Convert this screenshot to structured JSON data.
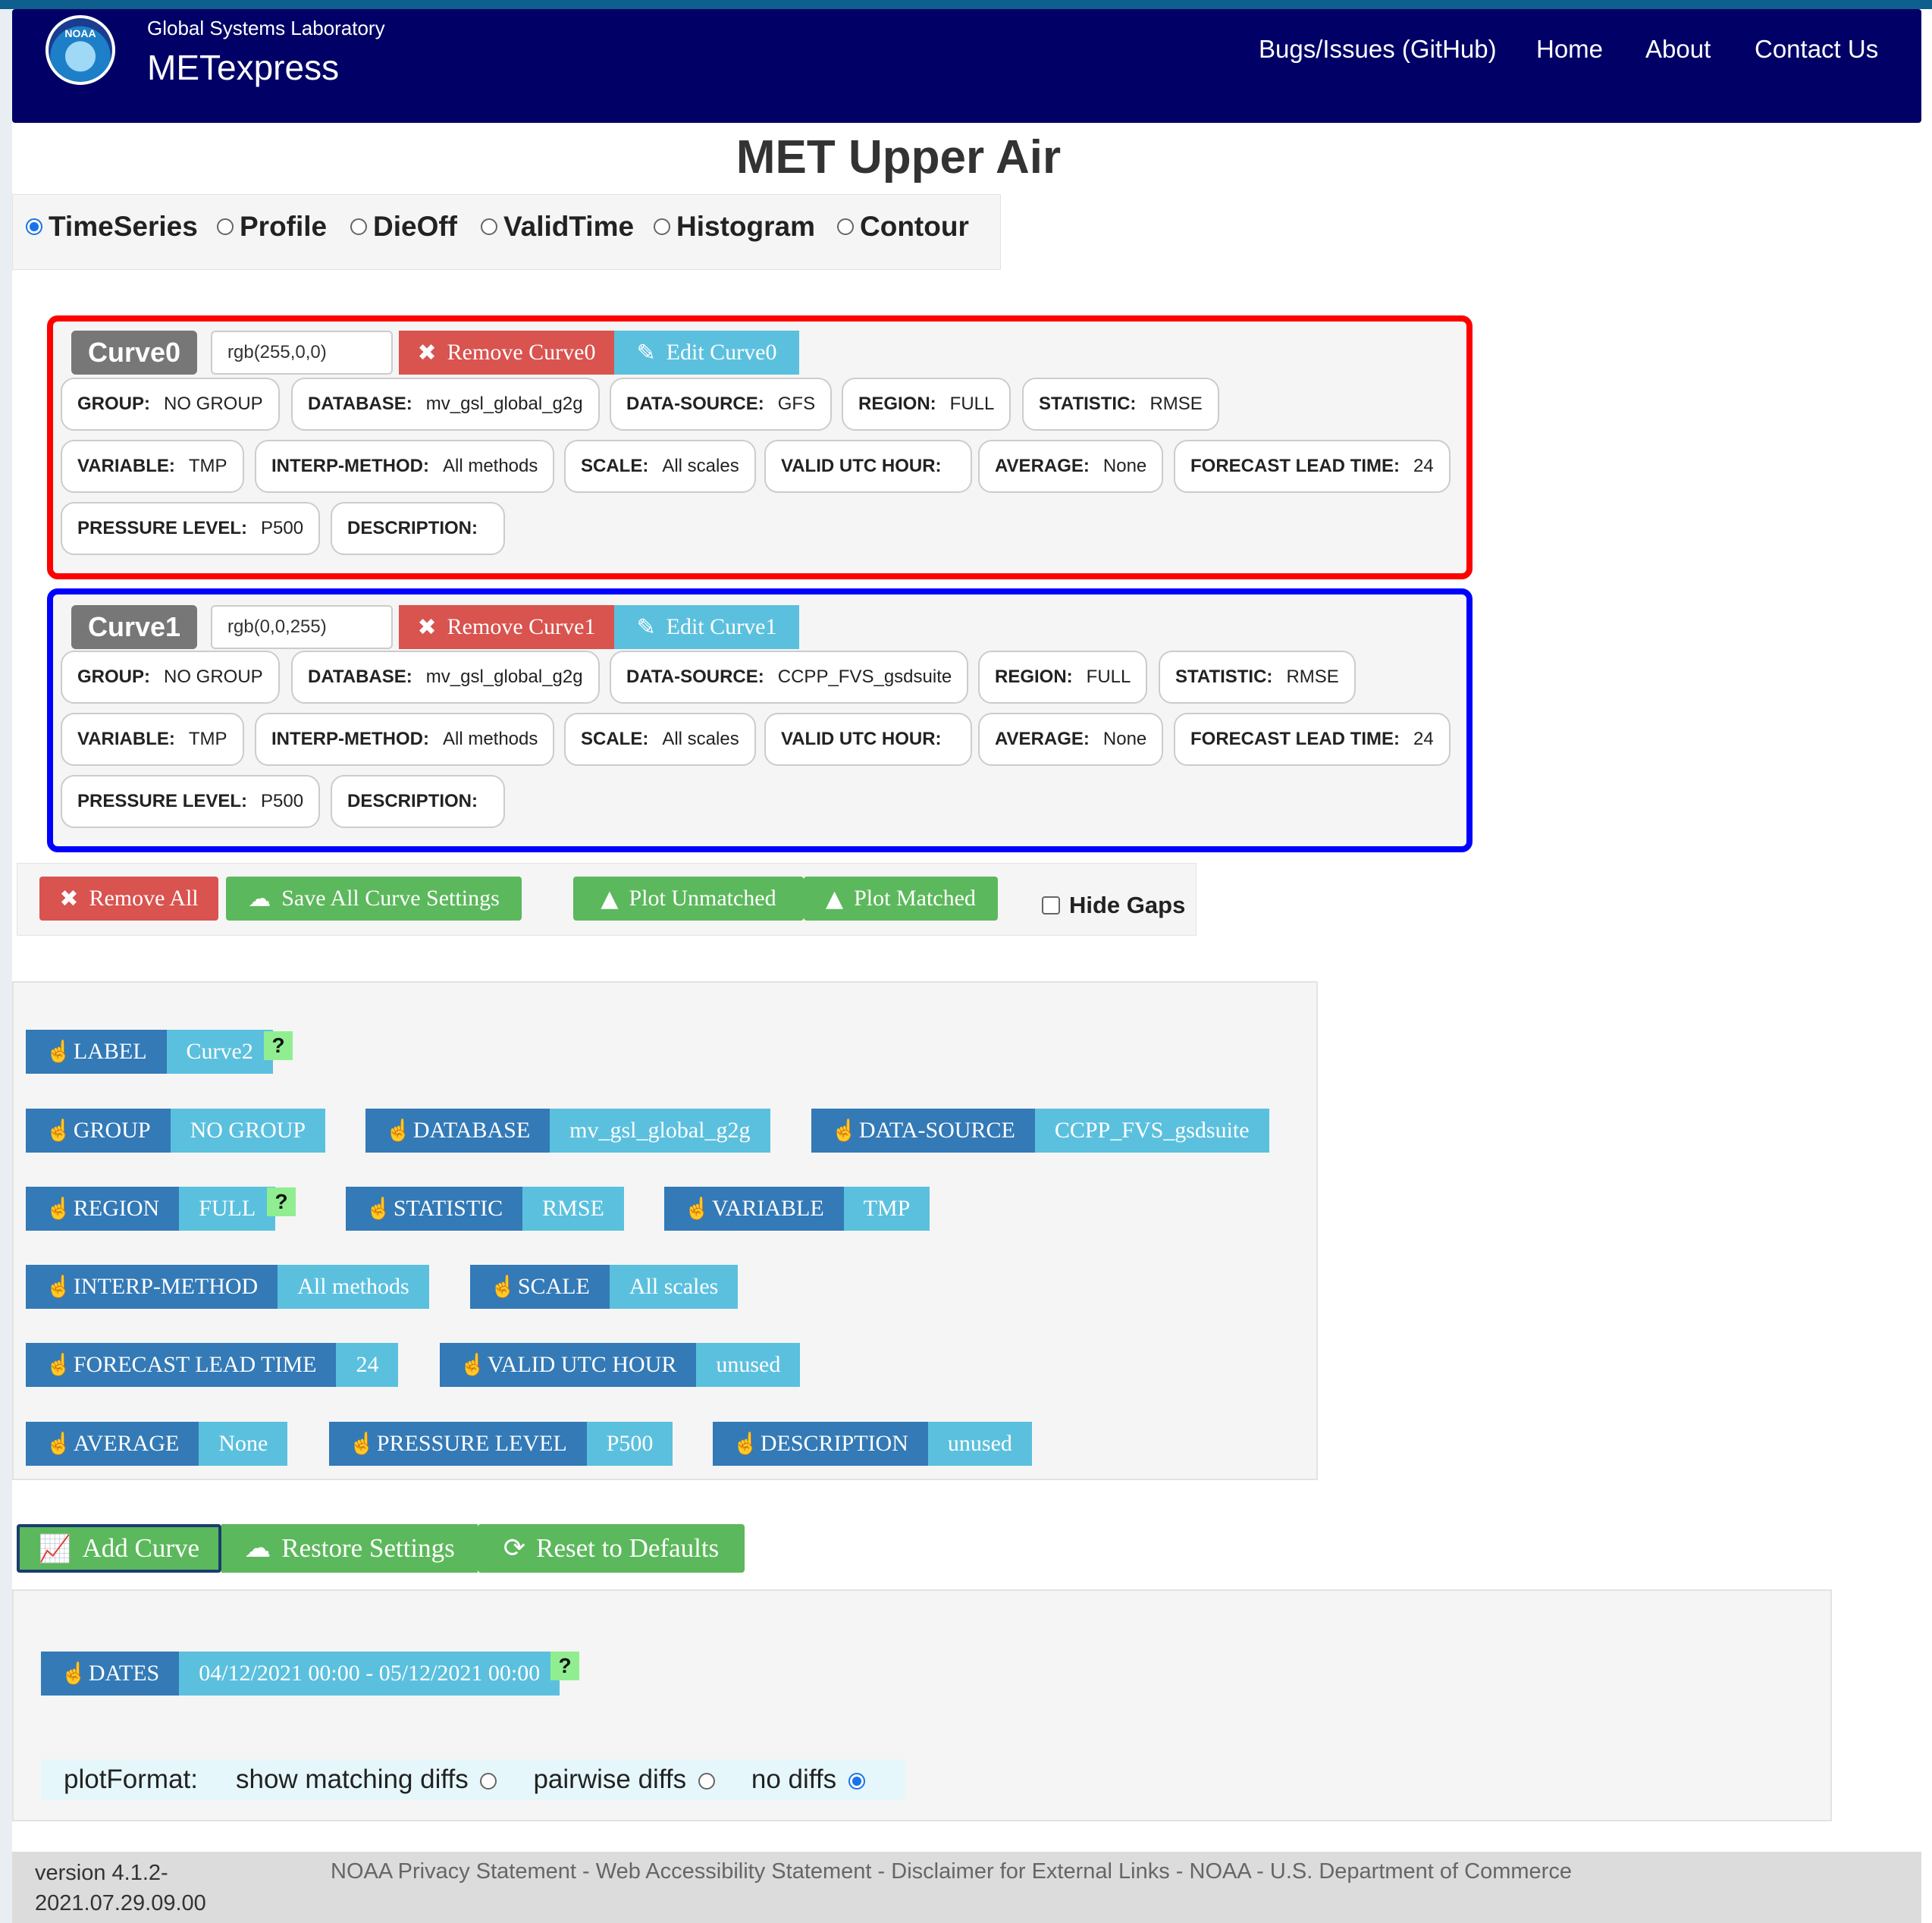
{
  "navbar": {
    "org": "Global Systems Laboratory",
    "app": "METexpress",
    "logo_text": "NOAA",
    "links": [
      "Bugs/Issues (GitHub)",
      "Home",
      "About",
      "Contact Us"
    ]
  },
  "page_title": "MET Upper Air",
  "plot_types": [
    {
      "label": "TimeSeries",
      "selected": true
    },
    {
      "label": "Profile",
      "selected": false
    },
    {
      "label": "DieOff",
      "selected": false
    },
    {
      "label": "ValidTime",
      "selected": false
    },
    {
      "label": "Histogram",
      "selected": false
    },
    {
      "label": "Contour",
      "selected": false
    }
  ],
  "curves": [
    {
      "label": "Curve0",
      "color": "rgb(255,0,0)",
      "border_color": "#ff0000",
      "remove_label": "Remove Curve0",
      "edit_label": "Edit Curve0",
      "fields": [
        {
          "k": "GROUP:",
          "v": "NO GROUP"
        },
        {
          "k": "DATABASE:",
          "v": "mv_gsl_global_g2g"
        },
        {
          "k": "DATA-SOURCE:",
          "v": "GFS"
        },
        {
          "k": "REGION:",
          "v": "FULL"
        },
        {
          "k": "STATISTIC:",
          "v": "RMSE"
        },
        {
          "k": "VARIABLE:",
          "v": "TMP"
        },
        {
          "k": "INTERP-METHOD:",
          "v": "All methods"
        },
        {
          "k": "SCALE:",
          "v": "All scales"
        },
        {
          "k": "VALID UTC HOUR:",
          "v": ""
        },
        {
          "k": "AVERAGE:",
          "v": "None"
        },
        {
          "k": "FORECAST LEAD TIME:",
          "v": "24"
        },
        {
          "k": "PRESSURE LEVEL:",
          "v": "P500"
        },
        {
          "k": "DESCRIPTION:",
          "v": ""
        }
      ]
    },
    {
      "label": "Curve1",
      "color": "rgb(0,0,255)",
      "border_color": "#0000ff",
      "remove_label": "Remove Curve1",
      "edit_label": "Edit Curve1",
      "fields": [
        {
          "k": "GROUP:",
          "v": "NO GROUP"
        },
        {
          "k": "DATABASE:",
          "v": "mv_gsl_global_g2g"
        },
        {
          "k": "DATA-SOURCE:",
          "v": "CCPP_FVS_gsdsuite"
        },
        {
          "k": "REGION:",
          "v": "FULL"
        },
        {
          "k": "STATISTIC:",
          "v": "RMSE"
        },
        {
          "k": "VARIABLE:",
          "v": "TMP"
        },
        {
          "k": "INTERP-METHOD:",
          "v": "All methods"
        },
        {
          "k": "SCALE:",
          "v": "All scales"
        },
        {
          "k": "VALID UTC HOUR:",
          "v": ""
        },
        {
          "k": "AVERAGE:",
          "v": "None"
        },
        {
          "k": "FORECAST LEAD TIME:",
          "v": "24"
        },
        {
          "k": "PRESSURE LEVEL:",
          "v": "P500"
        },
        {
          "k": "DESCRIPTION:",
          "v": ""
        }
      ]
    }
  ],
  "actions": {
    "remove_all": "Remove All",
    "save_all": "Save All Curve Settings",
    "plot_unmatched": "Plot Unmatched",
    "plot_matched": "Plot Matched",
    "hide_gaps": "Hide Gaps"
  },
  "params": {
    "label": {
      "name": "LABEL",
      "value": "Curve2"
    },
    "group": {
      "name": "GROUP",
      "value": "NO GROUP"
    },
    "database": {
      "name": "DATABASE",
      "value": "mv_gsl_global_g2g"
    },
    "data_source": {
      "name": "DATA-SOURCE",
      "value": "CCPP_FVS_gsdsuite"
    },
    "region": {
      "name": "REGION",
      "value": "FULL"
    },
    "statistic": {
      "name": "STATISTIC",
      "value": "RMSE"
    },
    "variable": {
      "name": "VARIABLE",
      "value": "TMP"
    },
    "interp_method": {
      "name": "INTERP-METHOD",
      "value": "All methods"
    },
    "scale": {
      "name": "SCALE",
      "value": "All scales"
    },
    "forecast_lead_time": {
      "name": "FORECAST LEAD TIME",
      "value": "24"
    },
    "valid_utc_hour": {
      "name": "VALID UTC HOUR",
      "value": "unused"
    },
    "average": {
      "name": "AVERAGE",
      "value": "None"
    },
    "pressure_level": {
      "name": "PRESSURE LEVEL",
      "value": "P500"
    },
    "description": {
      "name": "DESCRIPTION",
      "value": "unused"
    },
    "help": "?"
  },
  "bottom_buttons": {
    "add_curve": "Add Curve",
    "restore": "Restore Settings",
    "reset": "Reset to Defaults"
  },
  "dates": {
    "name": "DATES",
    "value": "04/12/2021 00:00 - 05/12/2021 00:00"
  },
  "plot_format": {
    "label": "plotFormat:",
    "options": [
      {
        "label": "show matching diffs",
        "selected": false
      },
      {
        "label": "pairwise diffs",
        "selected": false
      },
      {
        "label": "no diffs",
        "selected": true
      }
    ]
  },
  "footer": {
    "version": "version 4.1.2-2021.07.29.09.00",
    "links": [
      "NOAA Privacy Statement",
      "Web Accessibility Statement",
      "Disclaimer for External Links",
      "NOAA",
      "U.S. Department of Commerce"
    ],
    "separator": " - "
  }
}
